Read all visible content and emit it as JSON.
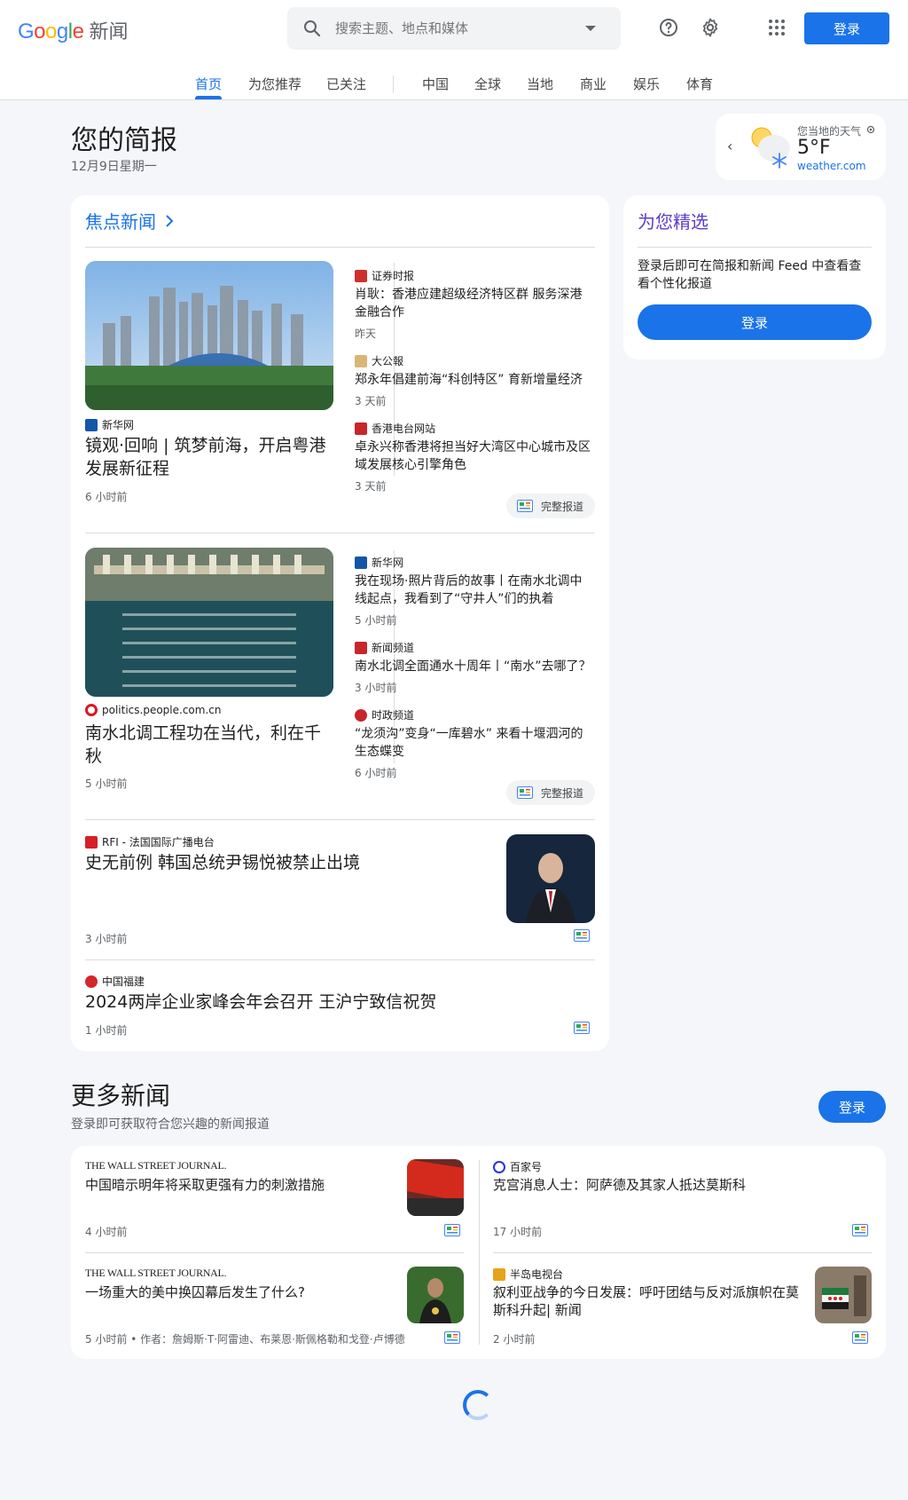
{
  "header": {
    "logo_word": "Google",
    "product": "新闻",
    "search_placeholder": "搜索主题、地点和媒体",
    "login": "登录",
    "icons": [
      "search-icon",
      "help-icon",
      "settings-icon",
      "apps-icon"
    ]
  },
  "tabs": [
    "首页",
    "为您推荐",
    "已关注",
    "中国",
    "全球",
    "当地",
    "商业",
    "娱乐",
    "体育"
  ],
  "brief": {
    "title": "您的简报",
    "date": "12月9日星期一"
  },
  "weather": {
    "label": "您当地的天气",
    "temp": "5°F",
    "source": "weather.com"
  },
  "top_stories": {
    "title": "焦点新闻",
    "full_coverage": "完整报道",
    "cluster1": {
      "main": {
        "source": "新华网",
        "headline": "镜观·回响 | 筑梦前海，开启粤港发展新征程",
        "time": "6 小时前"
      },
      "related": [
        {
          "source": "证券时报",
          "headline": "肖耿：香港应建超级经济特区群 服务深港金融合作",
          "time": "昨天"
        },
        {
          "source": "大公報",
          "headline": "郑永年倡建前海“科创特区” 育新增量经济",
          "time": "3 天前"
        },
        {
          "source": "香港电台网站",
          "headline": "卓永兴称香港将担当好大湾区中心城市及区域发展核心引擎角色",
          "time": "3 天前"
        }
      ]
    },
    "cluster2": {
      "main": {
        "source": "politics.people.com.cn",
        "headline": "南水北调工程功在当代，利在千秋",
        "time": "5 小时前"
      },
      "related": [
        {
          "source": "新华网",
          "headline": "我在现场·照片背后的故事丨在南水北调中线起点，我看到了“守井人”们的执着",
          "time": "5 小时前"
        },
        {
          "source": "新闻频道",
          "headline": "南水北调全面通水十周年丨“南水”去哪了？",
          "time": "3 小时前"
        },
        {
          "source": "时政频道",
          "headline": "“龙须沟”变身“一库碧水” 来看十堰泗河的生态蝶变",
          "time": "6 小时前"
        }
      ]
    },
    "single1": {
      "source": "RFI - 法国国际广播电台",
      "headline": "史无前例 韩国总统尹锡悦被禁止出境",
      "time": "3 小时前"
    },
    "single2": {
      "source": "中国福建",
      "headline": "2024两岸企业家峰会年会召开 王沪宁致信祝贺",
      "time": "1 小时前"
    }
  },
  "picks": {
    "title": "为您精选",
    "text": "登录后即可在简报和新闻 Feed 中查看查看个性化报道",
    "button": "登录"
  },
  "more": {
    "title": "更多新闻",
    "subtitle": "登录即可获取符合您兴趣的新闻报道",
    "login": "登录",
    "items": [
      {
        "source": "THE WALL STREET JOURNAL.",
        "headline": "中国暗示明年将采取更强有力的刺激措施",
        "time": "4 小时前"
      },
      {
        "source": "百家号",
        "headline": "克宫消息人士：阿萨德及其家人抵达莫斯科",
        "time": "17 小时前"
      },
      {
        "source": "THE WALL STREET JOURNAL.",
        "headline": "一场重大的美中换囚幕后发生了什么?",
        "time": "5 小时前 • 作者：詹姆斯·T·阿雷迪、布莱恩·斯佩格勒和戈登·卢博德"
      },
      {
        "source": "半岛电视台",
        "headline": "叙利亚战争的今日发展：呼吁团结与反对派旗帜在莫斯科升起| 新闻",
        "time": "2 小时前"
      }
    ]
  },
  "colors": {
    "accent": "#1a73e8",
    "picks_title": "#5b3ccc",
    "background": "#f5f6fa"
  }
}
